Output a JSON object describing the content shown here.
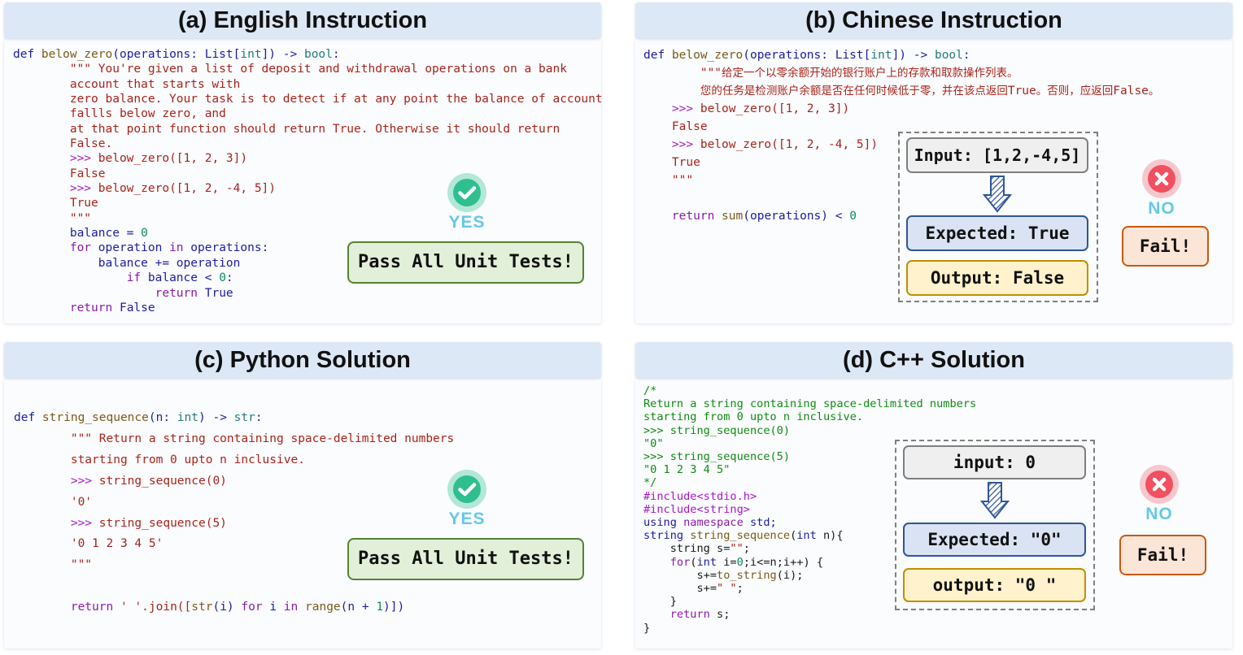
{
  "panels": {
    "a": {
      "title": "(a) English Instruction",
      "code": [
        [
          {
            "t": "def ",
            "c": "k-blue"
          },
          {
            "t": "below_zero",
            "c": "k-fn"
          },
          {
            "t": "(operations: List[",
            "c": "k-blue"
          },
          {
            "t": "int",
            "c": "k-type"
          },
          {
            "t": "]) -> ",
            "c": "k-blue"
          },
          {
            "t": "bool",
            "c": "k-type"
          },
          {
            "t": ":",
            "c": "k-blue"
          }
        ],
        [
          {
            "t": "        \"\"\" You're given a list of deposit and withdrawal operations on a bank",
            "c": "k-doc"
          }
        ],
        [
          {
            "t": "        account that starts with",
            "c": "k-doc"
          }
        ],
        [
          {
            "t": "        zero balance. Your task is to detect if at any point the balance of account",
            "c": "k-doc"
          }
        ],
        [
          {
            "t": "        fallls below zero, and",
            "c": "k-doc"
          }
        ],
        [
          {
            "t": "        at that point function should return True. Otherwise it should return",
            "c": "k-doc"
          }
        ],
        [
          {
            "t": "        False.",
            "c": "k-doc"
          }
        ],
        [
          {
            "t": "        >>> ",
            "c": "k-prompt"
          },
          {
            "t": "below_zero([1, 2, 3])",
            "c": "k-doc"
          }
        ],
        [
          {
            "t": "        False",
            "c": "k-doc"
          }
        ],
        [
          {
            "t": "        >>> ",
            "c": "k-prompt"
          },
          {
            "t": "below_zero([1, 2, -4, 5])",
            "c": "k-doc"
          }
        ],
        [
          {
            "t": "        True",
            "c": "k-doc"
          }
        ],
        [
          {
            "t": "        \"\"\"",
            "c": "k-doc"
          }
        ],
        [
          {
            "t": "        balance = ",
            "c": "k-blue"
          },
          {
            "t": "0",
            "c": "k-num"
          }
        ],
        [
          {
            "t": "        ",
            "c": "k-plain"
          },
          {
            "t": "for",
            "c": "k-kw"
          },
          {
            "t": " operation ",
            "c": "k-blue"
          },
          {
            "t": "in",
            "c": "k-kw"
          },
          {
            "t": " operations:",
            "c": "k-blue"
          }
        ],
        [
          {
            "t": "            balance += operation",
            "c": "k-blue"
          }
        ],
        [
          {
            "t": "                ",
            "c": "k-plain"
          },
          {
            "t": "if",
            "c": "k-kw"
          },
          {
            "t": " balance < ",
            "c": "k-blue"
          },
          {
            "t": "0",
            "c": "k-num"
          },
          {
            "t": ":",
            "c": "k-blue"
          }
        ],
        [
          {
            "t": "                    ",
            "c": "k-plain"
          },
          {
            "t": "return",
            "c": "k-kw"
          },
          {
            "t": " True",
            "c": "k-blue"
          }
        ],
        [
          {
            "t": "        ",
            "c": "k-plain"
          },
          {
            "t": "return",
            "c": "k-kw"
          },
          {
            "t": " False",
            "c": "k-blue"
          }
        ]
      ],
      "badge": "YES",
      "result": "Pass All Unit Tests!"
    },
    "b": {
      "title": "(b) Chinese Instruction",
      "code": [
        [
          {
            "t": "def ",
            "c": "k-blue"
          },
          {
            "t": "below_zero",
            "c": "k-fn"
          },
          {
            "t": "(operations: List[",
            "c": "k-blue"
          },
          {
            "t": "int",
            "c": "k-type"
          },
          {
            "t": "]) -> ",
            "c": "k-blue"
          },
          {
            "t": "bool",
            "c": "k-type"
          },
          {
            "t": ":",
            "c": "k-blue"
          }
        ],
        [
          {
            "t": "        \"\"\"",
            "c": "k-doc"
          },
          {
            "t": "给定一个以零余额开始的银行账户上的存款和取款操作列表。",
            "c": "k-doc cjk"
          }
        ],
        [
          {
            "t": "        ",
            "c": "k-doc"
          },
          {
            "t": "您的任务是检测账户余额是否在任何时候低于零，并在该点返回",
            "c": "k-doc cjk"
          },
          {
            "t": "True",
            "c": "k-doc"
          },
          {
            "t": "。否则，应返回",
            "c": "k-doc cjk"
          },
          {
            "t": "False",
            "c": "k-doc"
          },
          {
            "t": "。",
            "c": "k-doc cjk"
          }
        ],
        [
          {
            "t": "    >>> ",
            "c": "k-prompt"
          },
          {
            "t": "below_zero([1, 2, 3])",
            "c": "k-doc"
          }
        ],
        [
          {
            "t": "    False",
            "c": "k-doc"
          }
        ],
        [
          {
            "t": "    >>> ",
            "c": "k-prompt"
          },
          {
            "t": "below_zero([1, 2, -4, 5])",
            "c": "k-doc"
          }
        ],
        [
          {
            "t": "    True",
            "c": "k-doc"
          }
        ],
        [
          {
            "t": "    \"\"\"",
            "c": "k-doc"
          }
        ],
        [
          {
            "t": "",
            "c": "k-plain"
          }
        ],
        [
          {
            "t": "    ",
            "c": "k-plain"
          },
          {
            "t": "return",
            "c": "k-kw"
          },
          {
            "t": " ",
            "c": "k-plain"
          },
          {
            "t": "sum",
            "c": "k-fn"
          },
          {
            "t": "(operations) < ",
            "c": "k-blue"
          },
          {
            "t": "0",
            "c": "k-num"
          }
        ]
      ],
      "input": "Input: [1,2,-4,5]",
      "expected": "Expected: True",
      "output": "Output: False",
      "badge": "NO",
      "result": "Fail!"
    },
    "c": {
      "title": "(c) Python Solution",
      "code": [
        [
          {
            "t": "def ",
            "c": "k-blue"
          },
          {
            "t": "string_sequence",
            "c": "k-fn"
          },
          {
            "t": "(n: ",
            "c": "k-blue"
          },
          {
            "t": "int",
            "c": "k-type"
          },
          {
            "t": ") -> ",
            "c": "k-blue"
          },
          {
            "t": "str",
            "c": "k-type"
          },
          {
            "t": ":",
            "c": "k-blue"
          }
        ],
        [
          {
            "t": "        \"\"\" Return a string containing space-delimited numbers",
            "c": "k-doc"
          }
        ],
        [
          {
            "t": "        starting from 0 upto n inclusive.",
            "c": "k-doc"
          }
        ],
        [
          {
            "t": "        >>> ",
            "c": "k-prompt"
          },
          {
            "t": "string_sequence(0)",
            "c": "k-doc"
          }
        ],
        [
          {
            "t": "        '0'",
            "c": "k-doc"
          }
        ],
        [
          {
            "t": "        >>> ",
            "c": "k-prompt"
          },
          {
            "t": "string_sequence(5)",
            "c": "k-doc"
          }
        ],
        [
          {
            "t": "        '0 1 2 3 4 5'",
            "c": "k-doc"
          }
        ],
        [
          {
            "t": "        \"\"\"",
            "c": "k-doc"
          }
        ],
        [
          {
            "t": "",
            "c": "k-plain"
          }
        ],
        [
          {
            "t": "        ",
            "c": "k-plain"
          },
          {
            "t": "return",
            "c": "k-kw"
          },
          {
            "t": " ' '.join([",
            "c": "k-str"
          },
          {
            "t": "str",
            "c": "k-fn"
          },
          {
            "t": "(i) ",
            "c": "k-blue"
          },
          {
            "t": "for",
            "c": "k-kw"
          },
          {
            "t": " i ",
            "c": "k-blue"
          },
          {
            "t": "in",
            "c": "k-kw"
          },
          {
            "t": " ",
            "c": "k-plain"
          },
          {
            "t": "range",
            "c": "k-fn"
          },
          {
            "t": "(n + ",
            "c": "k-blue"
          },
          {
            "t": "1",
            "c": "k-num"
          },
          {
            "t": ")])",
            "c": "k-blue"
          }
        ]
      ],
      "badge": "YES",
      "result": "Pass All Unit Tests!"
    },
    "d": {
      "title": "(d) C++ Solution",
      "code": [
        [
          {
            "t": "/*",
            "c": "k-com"
          }
        ],
        [
          {
            "t": "Return a string containing space-delimited numbers",
            "c": "k-com"
          }
        ],
        [
          {
            "t": "starting from 0 upto n inclusive.",
            "c": "k-com"
          }
        ],
        [
          {
            "t": ">>> string_sequence(0)",
            "c": "k-com"
          }
        ],
        [
          {
            "t": "\"0\"",
            "c": "k-com"
          }
        ],
        [
          {
            "t": ">>> string_sequence(5)",
            "c": "k-com"
          }
        ],
        [
          {
            "t": "\"0 1 2 3 4 5\"",
            "c": "k-com"
          }
        ],
        [
          {
            "t": "*/",
            "c": "k-com"
          }
        ],
        [
          {
            "t": "#include<stdio.h>",
            "c": "k-pre"
          }
        ],
        [
          {
            "t": "#include<string>",
            "c": "k-pre"
          }
        ],
        [
          {
            "t": "using ",
            "c": "k-blue"
          },
          {
            "t": "namespace",
            "c": "k-kw"
          },
          {
            "t": " std;",
            "c": "k-blue"
          }
        ],
        [
          {
            "t": "string ",
            "c": "k-blue"
          },
          {
            "t": "string_sequence",
            "c": "k-fn"
          },
          {
            "t": "(",
            "c": "k-plain"
          },
          {
            "t": "int",
            "c": "k-blue"
          },
          {
            "t": " n){",
            "c": "k-plain"
          }
        ],
        [
          {
            "t": "    string s=",
            "c": "k-plain"
          },
          {
            "t": "\"\"",
            "c": "k-str"
          },
          {
            "t": ";",
            "c": "k-plain"
          }
        ],
        [
          {
            "t": "    ",
            "c": "k-plain"
          },
          {
            "t": "for",
            "c": "k-kw"
          },
          {
            "t": "(",
            "c": "k-plain"
          },
          {
            "t": "int",
            "c": "k-blue"
          },
          {
            "t": " i=",
            "c": "k-plain"
          },
          {
            "t": "0",
            "c": "k-num"
          },
          {
            "t": ";i<=n;i++) {",
            "c": "k-plain"
          }
        ],
        [
          {
            "t": "        s+=",
            "c": "k-plain"
          },
          {
            "t": "to_string",
            "c": "k-fn"
          },
          {
            "t": "(i);",
            "c": "k-plain"
          }
        ],
        [
          {
            "t": "        s+=",
            "c": "k-plain"
          },
          {
            "t": "\" \"",
            "c": "k-str"
          },
          {
            "t": ";",
            "c": "k-plain"
          }
        ],
        [
          {
            "t": "    }",
            "c": "k-plain"
          }
        ],
        [
          {
            "t": "    ",
            "c": "k-plain"
          },
          {
            "t": "return",
            "c": "k-kw"
          },
          {
            "t": " s;",
            "c": "k-plain"
          }
        ],
        [
          {
            "t": "}",
            "c": "k-plain"
          }
        ]
      ],
      "input": "input: 0",
      "expected": "Expected: \"0\"",
      "output": "output: \"0 \"",
      "badge": "NO",
      "result": "Fail!"
    }
  },
  "colors": {
    "title_bg": "#dde8f6",
    "pass_bg": "#e2efd9",
    "pass_border": "#548235",
    "yes_green": "#2fbf8f",
    "no_red": "#f05060",
    "badge_text": "#66c8e8",
    "input_bg": "#efefef",
    "expected_bg": "#dae3f3",
    "output_bg": "#fff2cc",
    "fail_bg": "#fbe5d6",
    "fail_border": "#c55a11"
  },
  "icons": {
    "yes": "check-circle-icon",
    "no": "x-circle-icon",
    "arrow": "striped-down-arrow-icon"
  }
}
